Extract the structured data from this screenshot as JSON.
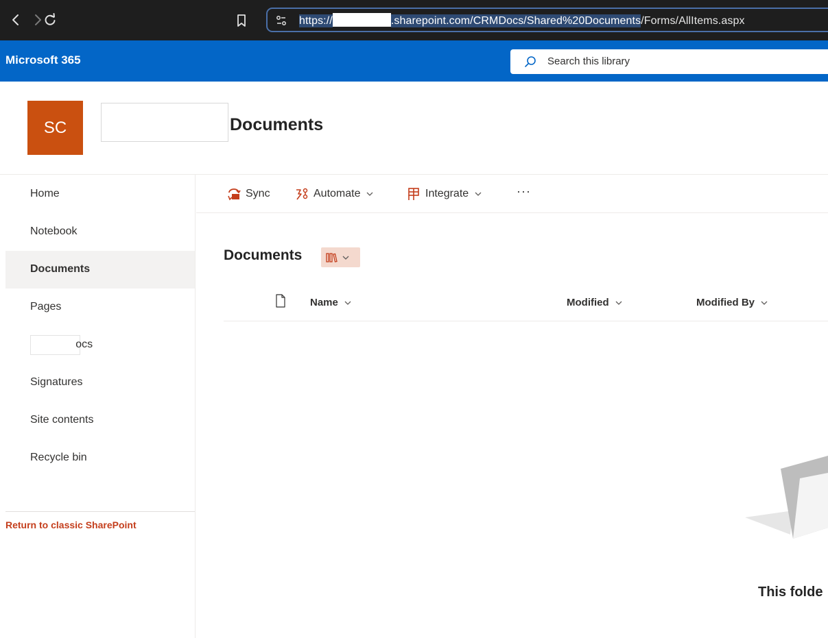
{
  "browser": {
    "url_prefix": "https://",
    "url_domain": ".sharepoint.com/CRMDocs/Shared%20Documents",
    "url_rest": "/Forms/AllItems.aspx"
  },
  "suite": {
    "title": "Microsoft 365",
    "search_placeholder": "Search this library"
  },
  "site": {
    "logo_initials": "SC",
    "logo_color": "#ca5010",
    "page_heading": "Documents"
  },
  "nav": {
    "items": [
      {
        "label": "Home"
      },
      {
        "label": "Notebook"
      },
      {
        "label": "Documents",
        "selected": true
      },
      {
        "label": "Pages"
      },
      {
        "label": "Docs",
        "partial": " ocs"
      },
      {
        "label": "Signatures"
      },
      {
        "label": "Site contents"
      },
      {
        "label": "Recycle bin"
      }
    ],
    "classic_link": "Return to classic SharePoint"
  },
  "commands": {
    "sync": "Sync",
    "automate": "Automate",
    "integrate": "Integrate",
    "more": "···"
  },
  "library": {
    "title": "Documents",
    "columns": {
      "name": "Name",
      "modified": "Modified",
      "modified_by": "Modified By"
    },
    "empty_text": "This folde"
  },
  "colors": {
    "suite_bar": "#0366c7",
    "accent": "#c43e1c",
    "view_button_bg": "#f4d9ce"
  }
}
